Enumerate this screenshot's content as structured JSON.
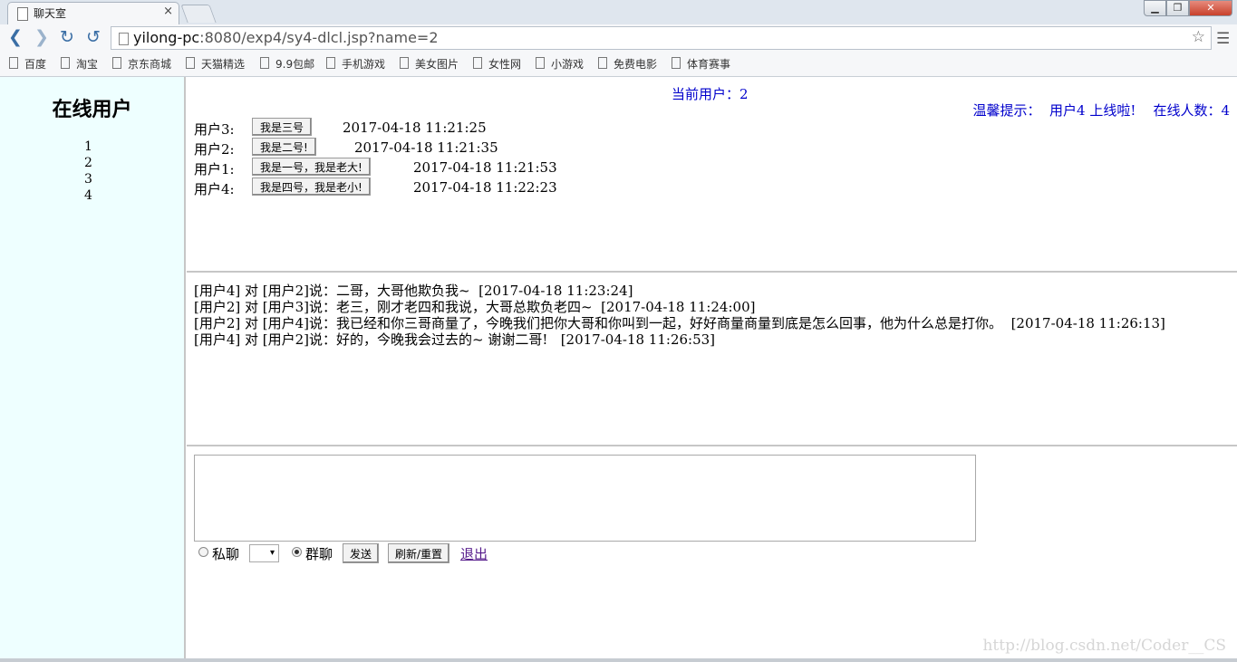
{
  "browser": {
    "tab_title": "聊天室",
    "tab_close": "×",
    "url_host": "yilong-pc",
    "url_path": ":8080/exp4/sy4-dlcl.jsp?name=2",
    "window_buttons": {
      "minimize": "▁",
      "maximize": "❐",
      "close": "✕"
    },
    "bookmarks": [
      "百度",
      "淘宝",
      "京东商城",
      "天猫精选",
      "9.9包邮",
      "手机游戏",
      "美女图片",
      "女性网",
      "小游戏",
      "免费电影",
      "体育赛事"
    ]
  },
  "sidebar": {
    "title": "在线用户",
    "users": [
      "1",
      "2",
      "3",
      "4"
    ]
  },
  "status": {
    "current_user": "当前用户：2",
    "tip": "温馨提示：  用户4 上线啦!    在线人数：4"
  },
  "signatures": [
    {
      "user": "用户3:",
      "text": "我是三号",
      "time": "2017-04-18 11:21:25"
    },
    {
      "user": "用户2:",
      "text": "我是二号!",
      "time": "2017-04-18 11:21:35"
    },
    {
      "user": "用户1:",
      "text": "我是一号，我是老大!",
      "time": "2017-04-18 11:21:53"
    },
    {
      "user": "用户4:",
      "text": "我是四号，我是老小!",
      "time": "2017-04-18 11:22:23"
    }
  ],
  "chat": [
    "[用户4] 对 [用户2]说：二哥，大哥他欺负我~  [2017-04-18 11:23:24]",
    "[用户2] 对 [用户3]说：老三，刚才老四和我说，大哥总欺负老四~  [2017-04-18 11:24:00]",
    "[用户2] 对 [用户4]说：我已经和你三哥商量了，今晚我们把你大哥和你叫到一起，好好商量商量到底是怎么回事，他为什么总是打你。  [2017-04-18 11:26:13]",
    "[用户4] 对 [用户2]说：好的，今晚我会过去的~ 谢谢二哥!   [2017-04-18 11:26:53]"
  ],
  "form": {
    "private_label": "私聊",
    "group_label": "群聊",
    "select_value": "▾",
    "send_label": "发送",
    "refresh_label": "刷新/重置",
    "exit_label": "退出"
  },
  "watermark": "http://blog.csdn.net/Coder__CS"
}
